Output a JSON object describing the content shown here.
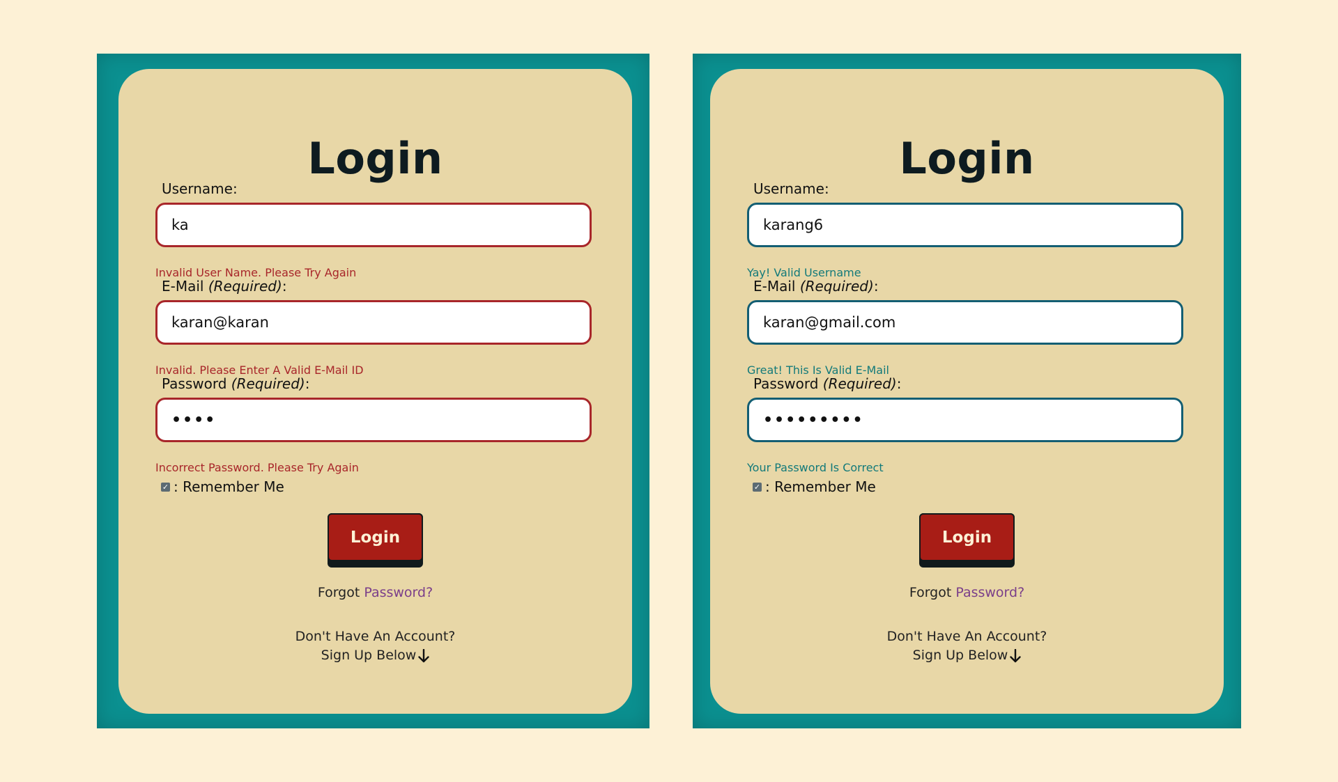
{
  "panels": [
    {
      "title": "Login",
      "username_label": "Username:",
      "username_value": "ka",
      "username_msg": "Invalid User Name. Please Try Again",
      "email_label": "E-Mail ",
      "email_label_req": "(Required)",
      "email_label_colon": ":",
      "email_value": "karan@karan",
      "email_msg": "Invalid. Please Enter A Valid E-Mail ID",
      "password_label": "Password ",
      "password_label_req": "(Required)",
      "password_label_colon": ":",
      "password_value": "••••",
      "password_msg": "Incorrect Password. Please Try Again",
      "remember_label": ": Remember Me",
      "remember_checked": true,
      "login_button": "Login",
      "forgot_text": "Forgot ",
      "forgot_link": "Password?",
      "no_account": "Don't Have An Account?",
      "signup_below": "Sign Up Below"
    },
    {
      "title": "Login",
      "username_label": "Username:",
      "username_value": "karang6",
      "username_msg": "Yay! Valid Username",
      "email_label": "E-Mail ",
      "email_label_req": "(Required)",
      "email_label_colon": ":",
      "email_value": "karan@gmail.com",
      "email_msg": "Great! This Is Valid E-Mail",
      "password_label": "Password ",
      "password_label_req": "(Required)",
      "password_label_colon": ":",
      "password_value": "•••••••••",
      "password_msg": "Your Password Is Correct",
      "remember_label": ": Remember Me",
      "remember_checked": true,
      "login_button": "Login",
      "forgot_text": "Forgot ",
      "forgot_link": "Password?",
      "no_account": "Don't Have An Account?",
      "signup_below": "Sign Up Below"
    }
  ],
  "colors": {
    "page_bg": "#fdf1d6",
    "frame": "#0b9090",
    "card": "#e8d7a7",
    "invalid": "#a8262a",
    "valid_border": "#135e73",
    "valid_text": "#137a7a",
    "button": "#a81d16",
    "link": "#7a3e8a"
  },
  "icons": {
    "checkbox": "checkbox-checked-icon",
    "arrow": "arrow-down-icon"
  }
}
